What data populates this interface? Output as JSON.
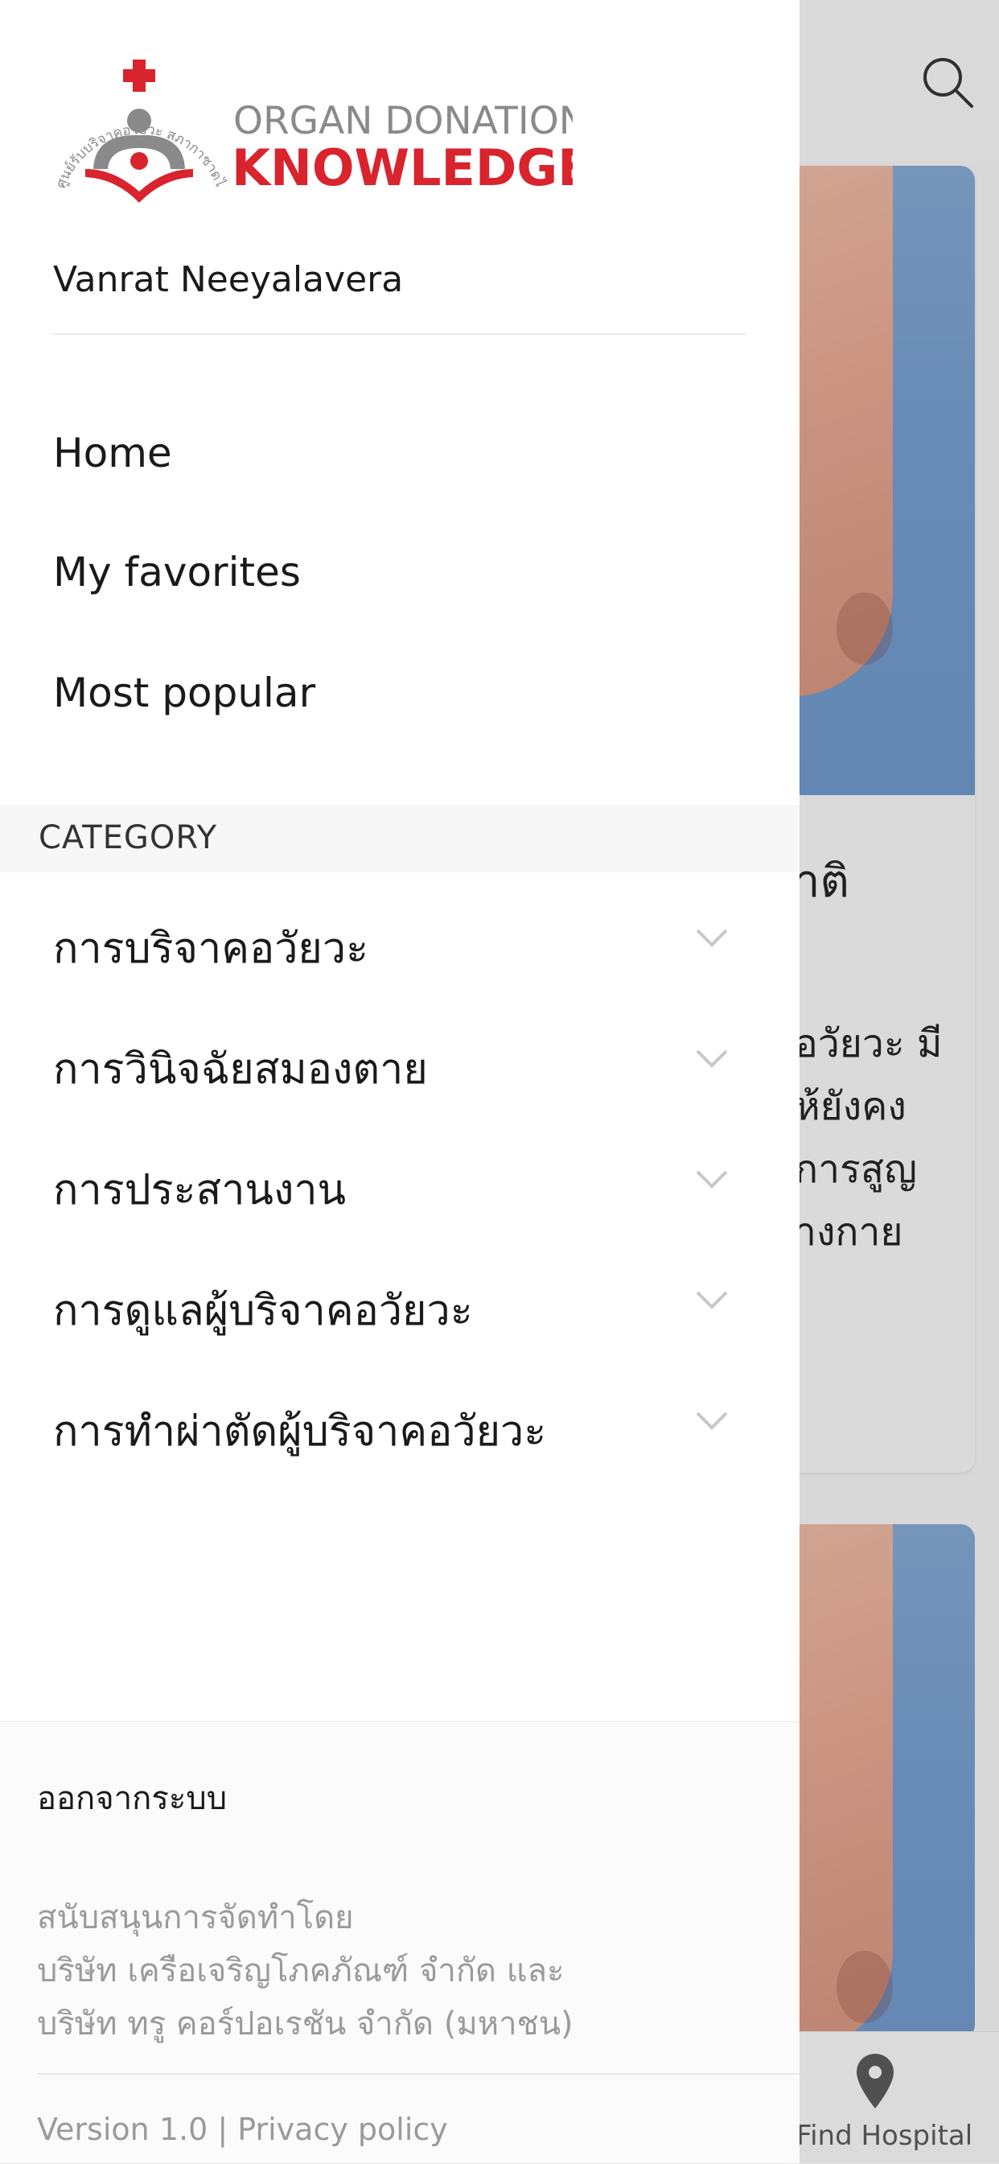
{
  "drawer": {
    "logo": {
      "line1": "ORGAN DONATION",
      "line2": "KNOWLEDGE",
      "arc_text": "ศูนย์รับบริจาคอวัยวะ สภากาชาดไทย",
      "red": "#d9232d",
      "gray": "#8a8a8a"
    },
    "user_name": "Vanrat Neeyalavera",
    "nav": [
      {
        "label": "Home"
      },
      {
        "label": "My favorites"
      },
      {
        "label": "Most popular"
      }
    ],
    "category_header": "CATEGORY",
    "categories": [
      {
        "label": "การบริจาคอวัยวะ",
        "icon": "chevron-down-icon"
      },
      {
        "label": "การวินิจฉัยสมองตาย",
        "icon": "chevron-down-icon"
      },
      {
        "label": "การประสานงาน",
        "icon": "chevron-down-icon"
      },
      {
        "label": "การดูแลผู้บริจาคอวัยวะ",
        "icon": "chevron-down-icon"
      },
      {
        "label": "การทำผ่าตัดผู้บริจาคอวัยวะ",
        "icon": "chevron-down-icon"
      }
    ],
    "footer": {
      "logout": "ออกจากระบบ",
      "support_lines": [
        "สนับสนุนการจัดทำโดย",
        "บริษัท เครือเจริญโภคภัณฑ์ จำกัด และ",
        "บริษัท ทรู คอร์ปอเรชัน จำกัด (มหาชน)"
      ],
      "version": "Version 1.0",
      "separator": "|",
      "privacy": "Privacy policy"
    }
  },
  "background": {
    "search_icon": "search-icon",
    "card": {
      "title_fragment": "าติ",
      "body_lines": [
        "อวัยวะ มี",
        "ห้ยังคง",
        "การสูญ",
        "างกาย"
      ]
    },
    "bottom_nav": {
      "icon": "map-pin-icon",
      "label": "Find Hospital"
    }
  }
}
